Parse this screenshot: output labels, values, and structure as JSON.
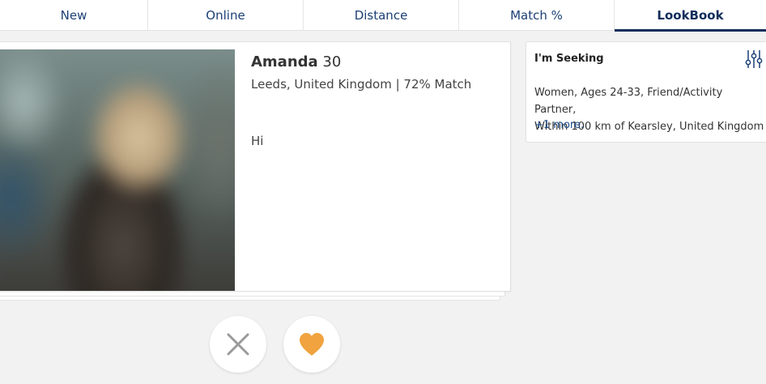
{
  "tabs": [
    {
      "label": "New",
      "active": false
    },
    {
      "label": "Online",
      "active": false
    },
    {
      "label": "Distance",
      "active": false
    },
    {
      "label": "Match %",
      "active": false
    },
    {
      "label": "LookBook",
      "active": true
    }
  ],
  "profile": {
    "name": "Amanda",
    "age": "30",
    "location": "Leeds, United Kingdom | 72% Match",
    "message": "Hi"
  },
  "actions": {
    "pass_icon": "close-icon",
    "like_icon": "heart-icon"
  },
  "seeking": {
    "title": "I'm Seeking",
    "line1": "Women, Ages 24-33, Friend/Activity Partner,",
    "line2": "Within 100 km of Kearsley, United Kingdom",
    "more": "+1 more."
  },
  "colors": {
    "accent": "#102d5a",
    "tab_text": "#1b3f75",
    "heart": "#f0a33e",
    "close": "#9a9a9a",
    "link": "#1b4a86"
  }
}
